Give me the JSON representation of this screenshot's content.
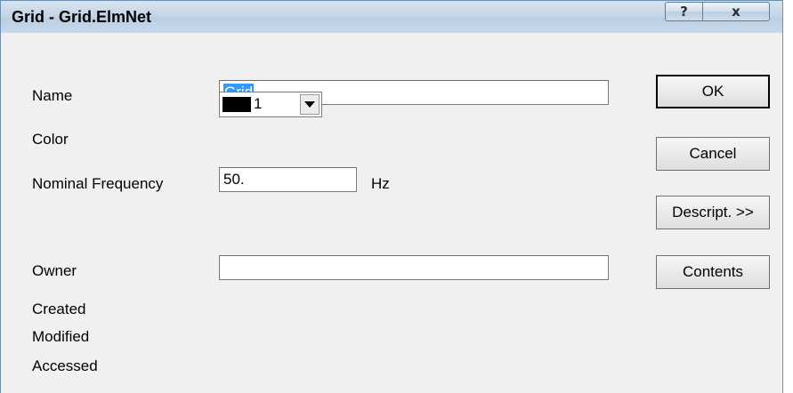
{
  "window": {
    "title": "Grid - Grid.ElmNet",
    "help_label": "?",
    "close_label": "x"
  },
  "form": {
    "name_label": "Name",
    "name_value": "Grid",
    "color_label": "Color",
    "color_value": "1",
    "color_swatch": "#000000",
    "frequency_label": "Nominal Frequency",
    "frequency_value": "50.",
    "frequency_unit": "Hz",
    "owner_label": "Owner",
    "owner_value": "",
    "created_label": "Created",
    "modified_label": "Modified",
    "accessed_label": "Accessed"
  },
  "buttons": {
    "ok": "OK",
    "cancel": "Cancel",
    "description": "Descript. >>",
    "contents": "Contents"
  }
}
